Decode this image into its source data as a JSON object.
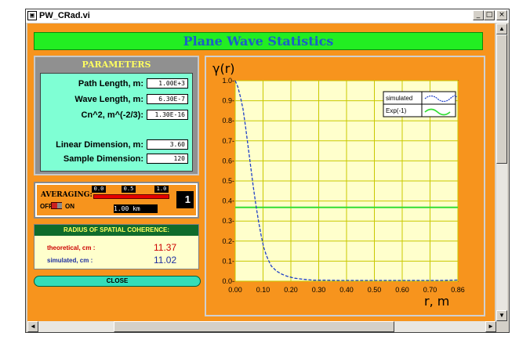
{
  "window": {
    "title": "PW_CRad.vi"
  },
  "panel": {
    "banner_title": "Plane Wave Statistics",
    "parameters": {
      "title": "PARAMETERS",
      "rows": [
        {
          "label": "Path Length, m:",
          "value": "1.00E+3"
        },
        {
          "label": "Wave Length, m:",
          "value": "6.30E-7"
        },
        {
          "label": "Cn^2, m^(-2/3):",
          "value": "1.30E-16"
        },
        {
          "label": "Linear Dimension, m:",
          "value": "3.60"
        },
        {
          "label": "Sample Dimension:",
          "value": "120"
        }
      ]
    },
    "averaging": {
      "label": "AVERAGING:",
      "scale": [
        "0.0",
        "0.5",
        "1.0"
      ],
      "off_label": "OFF",
      "on_label": "ON",
      "distance": "1.00    km",
      "count": "1"
    },
    "radius": {
      "title": "RADIUS OF SPATIAL COHERENCE:",
      "theoretical_label": "theoretical, cm :",
      "theoretical_value": "11.37",
      "simulated_label": "simulated, cm :",
      "simulated_value": "11.02"
    },
    "close_label": "CLOSE"
  },
  "colors": {
    "panel_bg": "#f7941d",
    "plot_bg": "#ffffcc",
    "grid": "#c8c800",
    "simulated_line": "#1e3fc8",
    "exp_line": "#33dd33"
  },
  "chart_data": {
    "type": "line",
    "ylabel": "γ(r)",
    "xlabel": "r, m",
    "xlim": [
      0,
      0.86
    ],
    "ylim": [
      0,
      1.0
    ],
    "xticks": [
      "0.00",
      "0.10",
      "0.20",
      "0.30",
      "0.40",
      "0.50",
      "0.60",
      "0.70",
      "0.86"
    ],
    "yticks": [
      "0.0-",
      "0.1-",
      "0.2-",
      "0.3-",
      "0.4-",
      "0.5-",
      "0.6-",
      "0.7-",
      "0.8-",
      "0.9-",
      "1.0-"
    ],
    "legend": "top-right",
    "series": [
      {
        "name": "simulated",
        "style": "dashed",
        "x": [
          0.0,
          0.01,
          0.02,
          0.03,
          0.04,
          0.05,
          0.06,
          0.07,
          0.08,
          0.09,
          0.1,
          0.11,
          0.12,
          0.13,
          0.14,
          0.16,
          0.18,
          0.2,
          0.23,
          0.26,
          0.3,
          0.35,
          0.4,
          0.5,
          0.6,
          0.7,
          0.8,
          0.86
        ],
        "y": [
          1.0,
          0.97,
          0.92,
          0.86,
          0.77,
          0.67,
          0.57,
          0.47,
          0.38,
          0.3,
          0.23,
          0.17,
          0.13,
          0.1,
          0.075,
          0.05,
          0.035,
          0.025,
          0.015,
          0.01,
          0.005,
          0.005,
          0.004,
          0.004,
          0.004,
          0.004,
          0.004,
          0.006
        ]
      },
      {
        "name": "Exp(-1)",
        "style": "solid",
        "x": [
          0.0,
          0.86
        ],
        "y": [
          0.368,
          0.368
        ]
      }
    ]
  }
}
